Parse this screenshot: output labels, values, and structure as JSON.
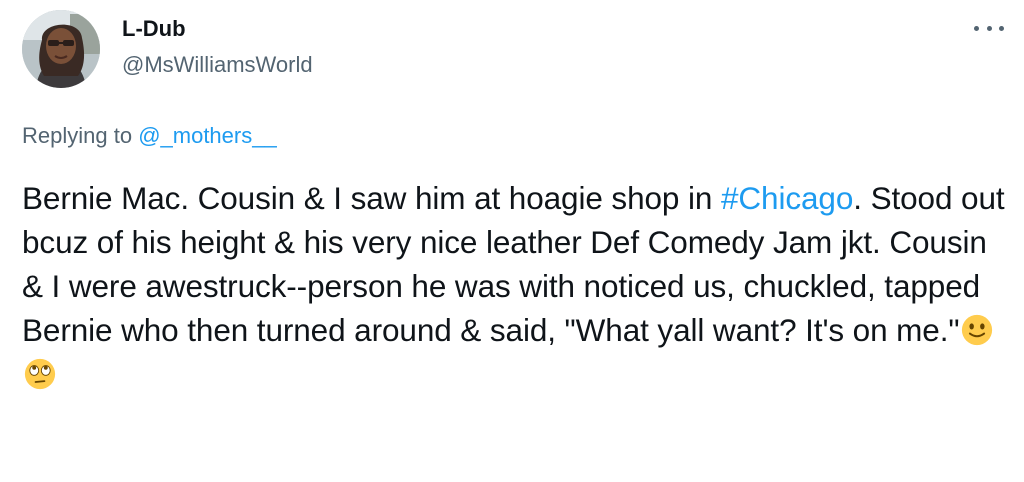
{
  "author": {
    "name": "L-Dub",
    "handle": "@MsWilliamsWorld"
  },
  "reply": {
    "prefix": "Replying to ",
    "to": "@_mothers__"
  },
  "tweet": {
    "part1": "Bernie Mac. Cousin & I saw him at hoagie shop in ",
    "hashtag": "#Chicago",
    "part2": ". Stood out bcuz of his height & his very nice leather Def Comedy Jam jkt. Cousin & I were awestruck--person he was with noticed us, chuckled, tapped Bernie who then turned around & said, \"What yall want? It's on me.\"",
    "emojis": [
      "slightly-smiling-face",
      "face-with-rolling-eyes"
    ]
  },
  "colors": {
    "link": "#1d9bf0",
    "secondary_text": "#536471",
    "primary_text": "#0f1419",
    "emoji_yellow": "#ffcc4d"
  }
}
